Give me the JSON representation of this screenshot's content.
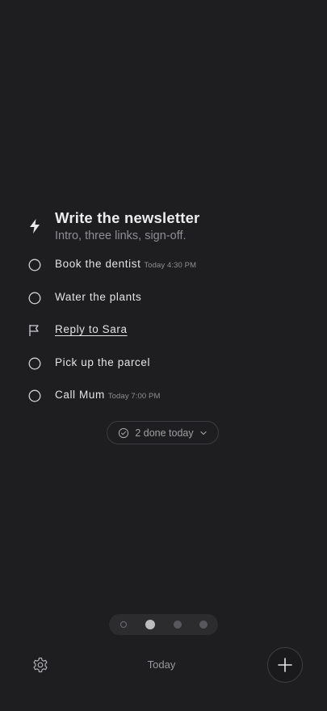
{
  "featured_task": {
    "title": "Write the newsletter",
    "subtitle": "Intro, three links, sign-off.",
    "icon": "bolt-icon"
  },
  "tasks": [
    {
      "label": "Book the dentist",
      "time": "Today 4:30 PM",
      "icon": "circle-icon",
      "flagged": false
    },
    {
      "label": "Water the plants",
      "time": "",
      "icon": "circle-icon",
      "flagged": false
    },
    {
      "label": "Reply to Sara",
      "time": "",
      "icon": "flag-icon",
      "flagged": true
    },
    {
      "label": "Pick up the parcel",
      "time": "",
      "icon": "circle-icon",
      "flagged": false
    },
    {
      "label": "Call Mum",
      "time": "Today 7:00 PM",
      "icon": "circle-icon",
      "flagged": false
    }
  ],
  "done_summary": {
    "label": "2 done today"
  },
  "pager": {
    "page_count": 4,
    "current_page": 2
  },
  "bottom_bar": {
    "title": "Today"
  },
  "colors": {
    "background": "#1e1e20",
    "text": "#e4e4e4",
    "muted": "#8f8f93"
  }
}
